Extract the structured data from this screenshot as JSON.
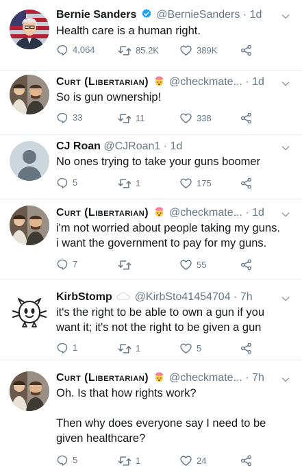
{
  "tweets": [
    {
      "author": "Bernie Sanders",
      "verified": true,
      "handle": "@BernieSanders",
      "time": "1d",
      "text": "Health care is a human right.",
      "replies": "4,064",
      "retweets": "85.2K",
      "likes": "389K",
      "avatar": "bernie-avatar"
    },
    {
      "author": "Curt (Libertarian)",
      "emoji": "exploding-head",
      "handle": "@checkmate...",
      "time": "1d",
      "text": "So is gun ownership!",
      "replies": "33",
      "retweets": "11",
      "likes": "338",
      "avatar": "curt-avatar"
    },
    {
      "author": "CJ Roan",
      "handle": "@CJRoan1",
      "time": "1d",
      "text": "No ones trying to take your guns boomer",
      "replies": "5",
      "retweets": "1",
      "likes": "175",
      "avatar": "default-avatar"
    },
    {
      "author": "Curt (Libertarian)",
      "emoji": "exploding-head",
      "handle": "@checkmate...",
      "time": "1d",
      "text": "i'm not worried about people taking my guns.\ni want the government to pay for my guns.",
      "replies": "7",
      "retweets": "",
      "likes": "55",
      "avatar": "curt-avatar"
    },
    {
      "author": "KirbStomp",
      "emoji": "speech-cloud",
      "handle": "@KirbSto41454704",
      "time": "7h",
      "text": "it's the right to be able to own a gun if you\nwant it; it's not the right to be given a gun",
      "replies": "1",
      "retweets": "1",
      "likes": "5",
      "avatar": "kirbstomp-avatar"
    },
    {
      "author": "Curt (Libertarian)",
      "emoji": "exploding-head",
      "handle": "@checkmate...",
      "time": "7h",
      "text": "Oh. Is that how rights work?\n\nThen why does everyone say I need to be\ngiven healthcare?",
      "replies": "5",
      "retweets": "1",
      "likes": "24",
      "avatar": "curt-avatar"
    }
  ],
  "colors": {
    "text": "#14171a",
    "muted": "#657786",
    "verified": "#1da1f2",
    "divider": "#e6ecf0"
  }
}
